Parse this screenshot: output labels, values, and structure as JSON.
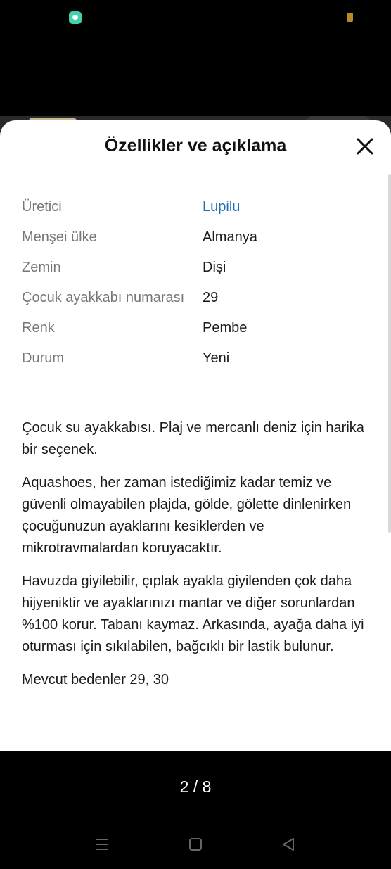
{
  "sheet": {
    "title": "Özellikler ve açıklama",
    "close_icon": "close-icon"
  },
  "properties": [
    {
      "label": "Üretici",
      "value": "Lupilu",
      "is_link": true
    },
    {
      "label": "Menşei ülke",
      "value": "Almanya",
      "is_link": false
    },
    {
      "label": "Zemin",
      "value": "Dişi",
      "is_link": false
    },
    {
      "label": "Çocuk ayakkabı numarası",
      "value": "29",
      "is_link": false
    },
    {
      "label": "Renk",
      "value": "Pembe",
      "is_link": false
    },
    {
      "label": "Durum",
      "value": "Yeni",
      "is_link": false
    }
  ],
  "description": [
    "Çocuk su ayakkabısı. Plaj ve mercanlı deniz için harika bir seçenek.",
    "Aquashoes, her zaman istediğimiz kadar temiz ve güvenli olmayabilen plajda, gölde, gölette dinlenirken çocuğunuzun ayaklarını kesiklerden ve mikrotravmalardan koruyacaktır.",
    "Havuzda giyilebilir, çıplak ayakla giyilenden çok daha hijyeniktir ve ayaklarınızı mantar ve diğer sorunlardan %100 korur. Tabanı kaymaz. Arkasında, ayağa daha iyi oturması için sıkılabilen, bağcıklı bir lastik bulunur.",
    "Mevcut bedenler 29, 30"
  ],
  "pager": {
    "text": "2 / 8"
  },
  "colors": {
    "link": "#1f6fb2",
    "label": "#777777",
    "background_overlay": "#000000"
  },
  "nav": {
    "recents_icon": "recents-icon",
    "home_icon": "home-icon",
    "back_icon": "back-icon"
  }
}
